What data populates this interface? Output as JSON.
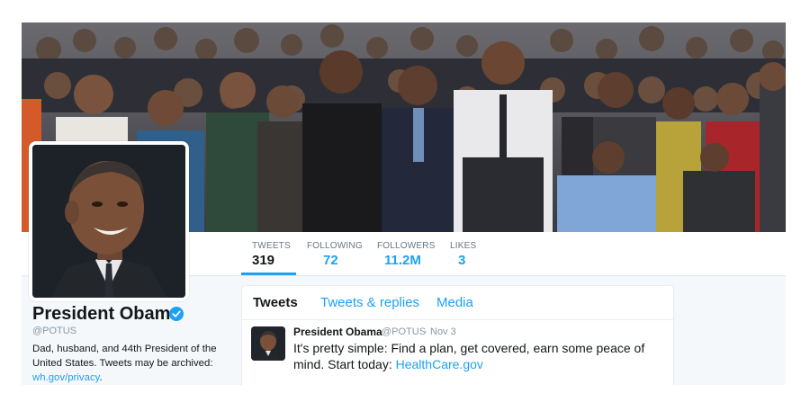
{
  "colors": {
    "accent": "#1da1f2",
    "text": "#14171a",
    "muted": "#657786",
    "background": "#f5f8fa"
  },
  "profile": {
    "name": "President Obama",
    "handle": "@POTUS",
    "verified_icon": "verified-badge-icon",
    "bio_line": "Dad, husband, and 44th President of the United States. Tweets may be archived: ",
    "bio_link": "wh.gov/privacy",
    "bio_end": "."
  },
  "stats": [
    {
      "label": "TWEETS",
      "value": "319"
    },
    {
      "label": "FOLLOWING",
      "value": "72"
    },
    {
      "label": "FOLLOWERS",
      "value": "11.2M"
    },
    {
      "label": "LIKES",
      "value": "3"
    }
  ],
  "timeline": {
    "tabs": [
      "Tweets",
      "Tweets & replies",
      "Media"
    ],
    "tweet": {
      "author": "President Obama",
      "handle": "@POTUS",
      "separator": "·",
      "date": "Nov 3",
      "text": "It's pretty simple: Find a plan, get covered, earn some peace of mind. Start today: ",
      "link": "HealthCare.gov"
    }
  }
}
